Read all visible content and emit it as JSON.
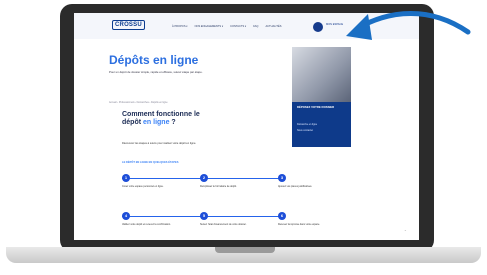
{
  "header": {
    "logo": "CROSSU",
    "nav_items": [
      "À PROPOS ▾",
      "NOS ENGAGEMENTS ▾",
      "CONTACTS ▾",
      "FAQ",
      "ACTUALITÉS"
    ],
    "account_text": "MON ESPACE"
  },
  "hero": {
    "title": "Dépôts en ligne",
    "subtitle": "Pour un dépôt de dossier simple, rapide et efficace, suivez étape par étape."
  },
  "breadcrumb": "Accueil  ›  Professionnels  ›  Démarches  ›  Dépôts en ligne",
  "card": {
    "title": "DÉPOSEZ VOTRE DOSSIER",
    "links": [
      "Démarche en ligne",
      "Nous contacter"
    ]
  },
  "section": {
    "title_line1": "Comment fonctionne le",
    "title_line2_a": "dépôt",
    "title_line2_b": "en ligne",
    "title_line2_c": "?",
    "description": "Découvrez les étapes à suivre pour réaliser votre dépôt en ligne.",
    "steps_title": "LE DÉPÔT EN LIGNE EN QUELQUES ÉTAPES"
  },
  "steps": [
    {
      "num": "1",
      "text": "Créez votre espace personnel en ligne."
    },
    {
      "num": "2",
      "text": "Remplissez le formulaire de dépôt."
    },
    {
      "num": "3",
      "text": "Ajoutez vos pièces justificatives."
    },
    {
      "num": "4",
      "text": "Validez votre dépôt et recevez la confirmation."
    },
    {
      "num": "5",
      "text": "Suivez l'état d'avancement de votre dossier."
    },
    {
      "num": "6",
      "text": "Recevez la réponse dans votre espace."
    }
  ],
  "page_corner": "→"
}
